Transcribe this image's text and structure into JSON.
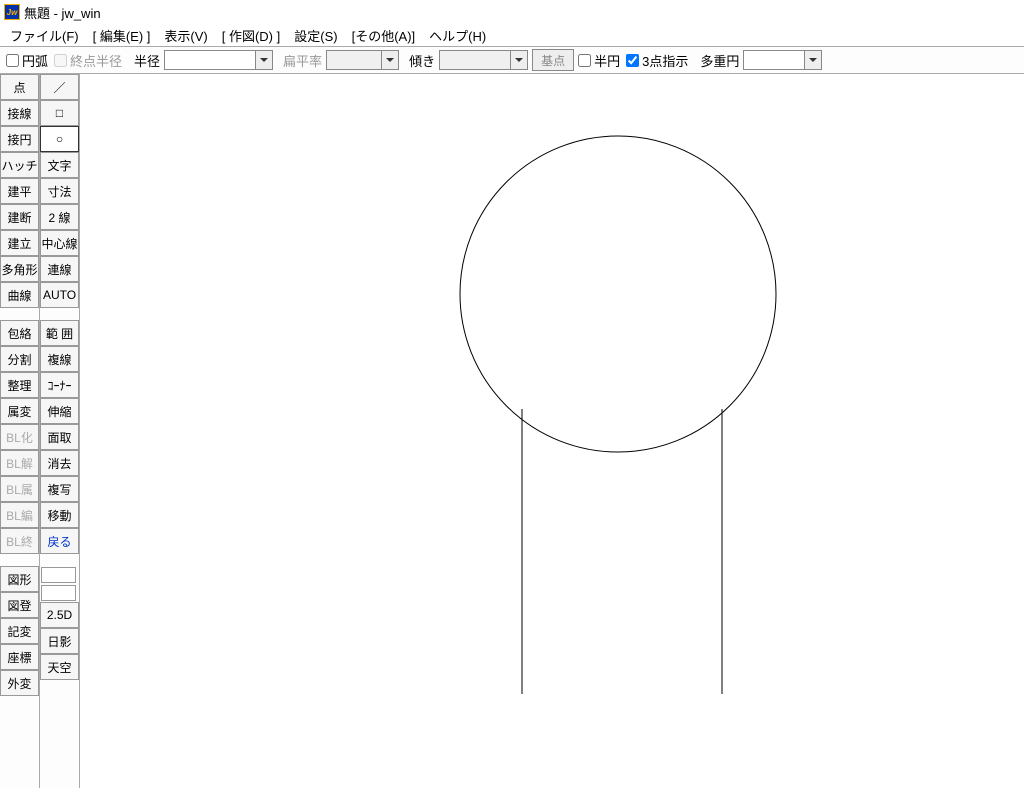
{
  "title": "無題 - jw_win",
  "menu": {
    "file": "ファイル(F)",
    "edit": "[ 編集(E) ]",
    "view": "表示(V)",
    "draw": "[ 作図(D) ]",
    "settings": "設定(S)",
    "other": "[その他(A)]",
    "help": "ヘルプ(H)"
  },
  "options": {
    "arc": "円弧",
    "end_radius": "終点半径",
    "radius": "半径",
    "flatness": "扁平率",
    "tilt": "傾き",
    "basepoint": "基点",
    "half_circle": "半円",
    "three_point": "3点指示",
    "multi_circle": "多重円",
    "radius_val": "",
    "flatness_val": "",
    "tilt_val": "",
    "multi_val": ""
  },
  "left_tools": {
    "col1": [
      "点",
      "接線",
      "接円",
      "ハッチ",
      "建平",
      "建断",
      "建立",
      "多角形",
      "曲線"
    ],
    "col1b": [
      "包絡",
      "分割",
      "整理",
      "属変",
      "BL化",
      "BL解",
      "BL属",
      "BL編",
      "BL終"
    ],
    "col1c": [
      "図形",
      "図登",
      "記変",
      "座標",
      "外変"
    ],
    "col2": [
      "／",
      "□",
      "○",
      "文字",
      "寸法",
      "2 線",
      "中心線",
      "連線",
      "AUTO"
    ],
    "col2b": [
      "範 囲",
      "複線",
      "ｺｰﾅｰ",
      "伸縮",
      "面取",
      "消去",
      "複写",
      "移動",
      "戻る"
    ],
    "col2c": [
      "2.5D",
      "日影",
      "天空"
    ]
  }
}
